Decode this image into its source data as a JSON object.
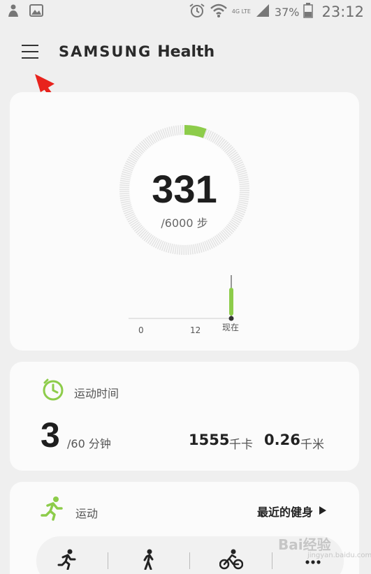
{
  "status_bar": {
    "network": "4G LTE",
    "battery": "37%",
    "time": "23:12"
  },
  "header": {
    "brand_samsung": "SAMSUNG",
    "brand_health": "Health"
  },
  "steps_card": {
    "count": "331",
    "goal": "/6000 步",
    "progress_fraction": 0.055,
    "chart_ticks": [
      "0",
      "12",
      "现在"
    ],
    "accent": "#8dcc4a"
  },
  "exercise_time_card": {
    "title": "运动时间",
    "minutes": "3",
    "goal": "/60 分钟",
    "kcal_value": "1555",
    "kcal_unit": "千卡",
    "distance_value": "0.26",
    "distance_unit": "千米"
  },
  "exercise_card": {
    "title": "运动",
    "recent_label": "最近的健身",
    "activities": [
      "running-icon",
      "walking-icon",
      "cycling-icon",
      "more-icon"
    ]
  },
  "watermark": {
    "text": "Bai经验",
    "sub": "jingyan.baidu.com"
  }
}
